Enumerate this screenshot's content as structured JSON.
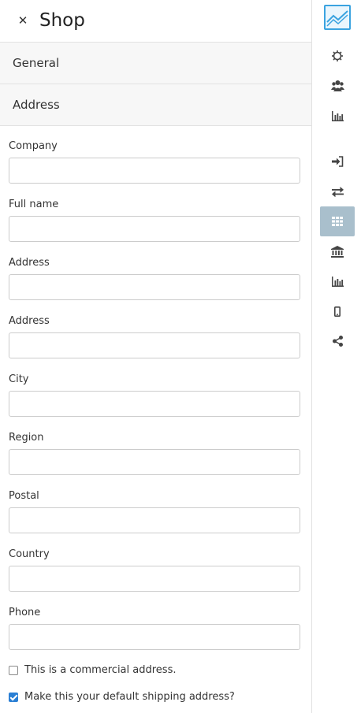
{
  "header": {
    "close_icon": "close-icon",
    "title": "Shop"
  },
  "sections": {
    "general": "General",
    "address": "Address"
  },
  "form": {
    "fields": [
      {
        "label": "Company",
        "value": "",
        "placeholder": ""
      },
      {
        "label": "Full name",
        "value": "",
        "placeholder": ""
      },
      {
        "label": "Address",
        "value": "",
        "placeholder": ""
      },
      {
        "label": "Address",
        "value": "",
        "placeholder": ""
      },
      {
        "label": "City",
        "value": "",
        "placeholder": ""
      },
      {
        "label": "Region",
        "value": "",
        "placeholder": ""
      },
      {
        "label": "Postal",
        "value": "",
        "placeholder": ""
      },
      {
        "label": "Country",
        "value": "",
        "placeholder": ""
      },
      {
        "label": "Phone",
        "value": "",
        "placeholder": ""
      }
    ],
    "commercial": {
      "label": "This is a commercial address.",
      "checked": false
    },
    "default_shipping": {
      "label": "Make this your default shipping address?",
      "checked": true
    }
  },
  "rail": {
    "items": [
      {
        "icon": "gear-icon"
      },
      {
        "icon": "users-icon"
      },
      {
        "icon": "bar-chart-icon"
      },
      {
        "icon": "sign-in-icon"
      },
      {
        "icon": "exchange-icon"
      },
      {
        "icon": "grid-icon",
        "active": true
      },
      {
        "icon": "bank-icon"
      },
      {
        "icon": "bar-chart-icon"
      },
      {
        "icon": "mobile-icon"
      },
      {
        "icon": "share-icon"
      }
    ]
  },
  "colors": {
    "accent": "#2a7fd4",
    "logo": "#3aa3e0",
    "rail_active": "#a9bfcc",
    "section_bg": "#f7f7f7",
    "border": "#e2e2e2"
  }
}
